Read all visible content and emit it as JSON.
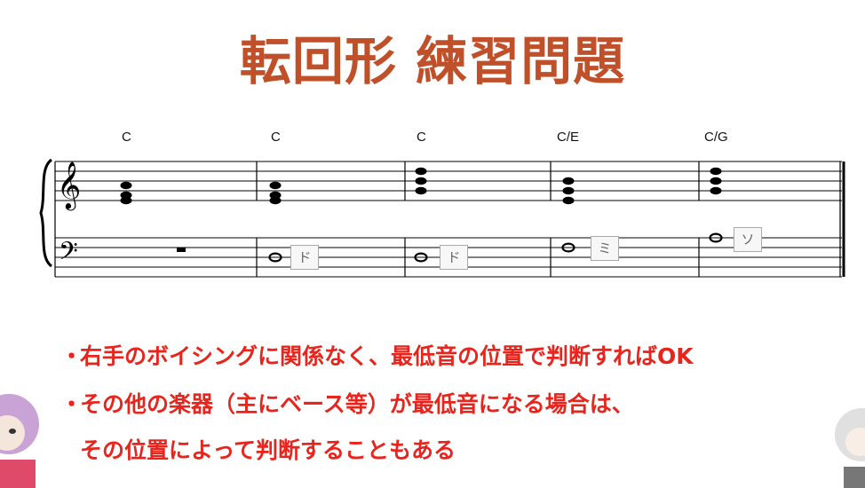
{
  "title": "転回形 練習問題",
  "chords": [
    "C",
    "C",
    "C",
    "C/E",
    "C/G"
  ],
  "bass_labels": [
    "ド",
    "ド",
    "ミ",
    "ソ"
  ],
  "bullets": [
    "右手のボイシングに関係なく、最低音の位置で判断すればOK",
    "その他の楽器（主にベース等）が最低音になる場合は、"
  ],
  "bullet_continuation": "その位置によって判断することもある",
  "colors": {
    "title": "#c0502a",
    "bullet_text": "#e8241c"
  }
}
